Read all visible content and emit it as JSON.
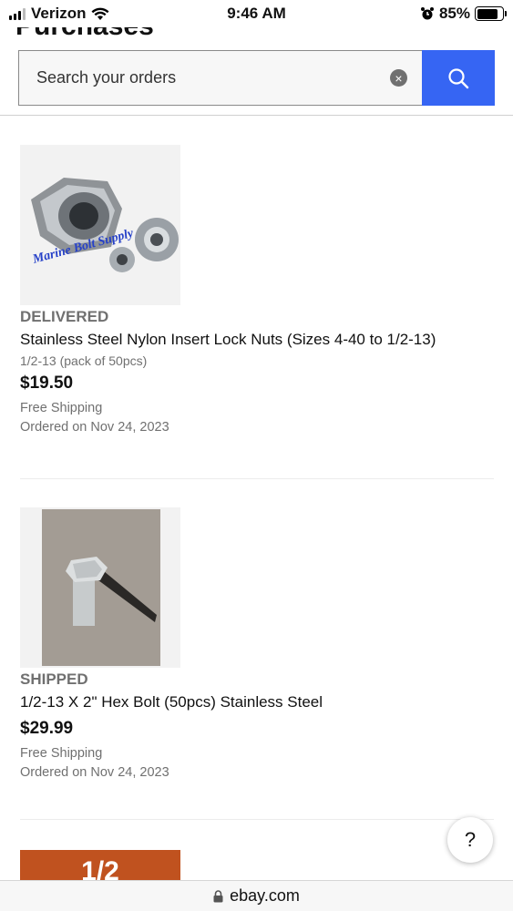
{
  "status_bar": {
    "carrier": "Verizon",
    "time": "9:46 AM",
    "battery": "85%"
  },
  "page": {
    "heading": "Purchases"
  },
  "search": {
    "placeholder": "Search your orders"
  },
  "orders": [
    {
      "status": "DELIVERED",
      "title": "Stainless Steel Nylon Insert Lock Nuts (Sizes 4-40 to 1/2-13)",
      "variant": "1/2-13 (pack of 50pcs)",
      "price": "$19.50",
      "shipping": "Free Shipping",
      "ordered": "Ordered on Nov 24, 2023",
      "image_watermark": "Marine Bolt Supply"
    },
    {
      "status": "SHIPPED",
      "title": "1/2-13 X 2\" Hex Bolt (50pcs) Stainless Steel",
      "price": "$29.99",
      "shipping": "Free Shipping",
      "ordered": "Ordered on Nov 24, 2023"
    },
    {
      "image_text": "1/2"
    }
  ],
  "help": {
    "label": "?"
  },
  "url_bar": {
    "domain": "ebay.com"
  },
  "colors": {
    "accent": "#3665f3",
    "muted": "#707070"
  }
}
